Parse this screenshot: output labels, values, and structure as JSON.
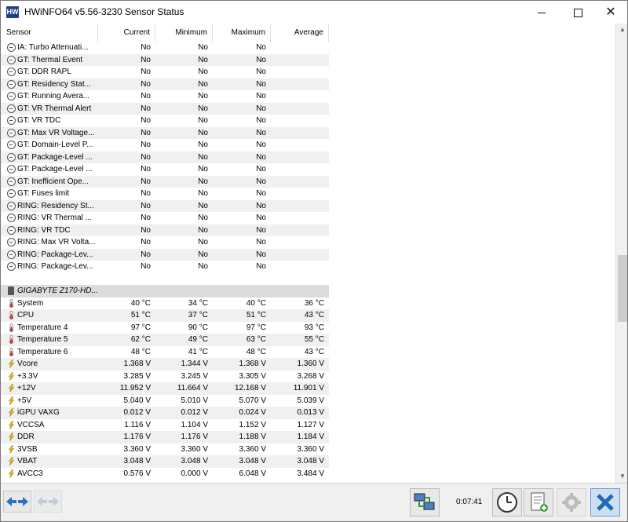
{
  "window": {
    "title": "HWiNFO64 v5.56-3230 Sensor Status",
    "icon_text": "HW"
  },
  "columns": {
    "sensor": "Sensor",
    "current": "Current",
    "minimum": "Minimum",
    "maximum": "Maximum",
    "average": "Average"
  },
  "rows": [
    {
      "name": "IA: Turbo Attenuati...",
      "cur": "No",
      "min": "No",
      "max": "No",
      "avg": "",
      "icon": "circle-minus-icon"
    },
    {
      "name": "GT: Thermal Event",
      "cur": "No",
      "min": "No",
      "max": "No",
      "avg": "",
      "icon": "circle-minus-icon"
    },
    {
      "name": "GT: DDR RAPL",
      "cur": "No",
      "min": "No",
      "max": "No",
      "avg": "",
      "icon": "circle-minus-icon"
    },
    {
      "name": "GT: Residency Stat...",
      "cur": "No",
      "min": "No",
      "max": "No",
      "avg": "",
      "icon": "circle-minus-icon"
    },
    {
      "name": "GT: Running Avera...",
      "cur": "No",
      "min": "No",
      "max": "No",
      "avg": "",
      "icon": "circle-minus-icon"
    },
    {
      "name": "GT: VR Thermal Alert",
      "cur": "No",
      "min": "No",
      "max": "No",
      "avg": "",
      "icon": "circle-minus-icon"
    },
    {
      "name": "GT: VR TDC",
      "cur": "No",
      "min": "No",
      "max": "No",
      "avg": "",
      "icon": "circle-minus-icon"
    },
    {
      "name": "GT: Max VR Voltage...",
      "cur": "No",
      "min": "No",
      "max": "No",
      "avg": "",
      "icon": "circle-minus-icon"
    },
    {
      "name": "GT: Domain-Level P...",
      "cur": "No",
      "min": "No",
      "max": "No",
      "avg": "",
      "icon": "circle-minus-icon"
    },
    {
      "name": "GT: Package-Level ...",
      "cur": "No",
      "min": "No",
      "max": "No",
      "avg": "",
      "icon": "circle-minus-icon"
    },
    {
      "name": "GT: Package-Level ...",
      "cur": "No",
      "min": "No",
      "max": "No",
      "avg": "",
      "icon": "circle-minus-icon"
    },
    {
      "name": "GT: Inefficient Ope...",
      "cur": "No",
      "min": "No",
      "max": "No",
      "avg": "",
      "icon": "circle-minus-icon"
    },
    {
      "name": "GT: Fuses limit",
      "cur": "No",
      "min": "No",
      "max": "No",
      "avg": "",
      "icon": "circle-minus-icon"
    },
    {
      "name": "RING: Residency St...",
      "cur": "No",
      "min": "No",
      "max": "No",
      "avg": "",
      "icon": "circle-minus-icon"
    },
    {
      "name": "RING: VR Thermal ...",
      "cur": "No",
      "min": "No",
      "max": "No",
      "avg": "",
      "icon": "circle-minus-icon"
    },
    {
      "name": "RING: VR TDC",
      "cur": "No",
      "min": "No",
      "max": "No",
      "avg": "",
      "icon": "circle-minus-icon"
    },
    {
      "name": "RING: Max VR Volta...",
      "cur": "No",
      "min": "No",
      "max": "No",
      "avg": "",
      "icon": "circle-minus-icon"
    },
    {
      "name": "RING: Package-Lev...",
      "cur": "No",
      "min": "No",
      "max": "No",
      "avg": "",
      "icon": "circle-minus-icon"
    },
    {
      "name": "RING: Package-Lev...",
      "cur": "No",
      "min": "No",
      "max": "No",
      "avg": "",
      "icon": "circle-minus-icon"
    },
    {
      "type": "spacer"
    },
    {
      "type": "group",
      "name": "GIGABYTE Z170-HD...",
      "icon": "chip-icon"
    },
    {
      "name": "System",
      "cur": "40 °C",
      "min": "34 °C",
      "max": "40 °C",
      "avg": "36 °C",
      "icon": "thermometer-icon"
    },
    {
      "name": "CPU",
      "cur": "51 °C",
      "min": "37 °C",
      "max": "51 °C",
      "avg": "43 °C",
      "icon": "thermometer-icon"
    },
    {
      "name": "Temperature 4",
      "cur": "97 °C",
      "min": "90 °C",
      "max": "97 °C",
      "avg": "93 °C",
      "icon": "thermometer-icon"
    },
    {
      "name": "Temperature 5",
      "cur": "62 °C",
      "min": "49 °C",
      "max": "63 °C",
      "avg": "55 °C",
      "icon": "thermometer-icon"
    },
    {
      "name": "Temperature 6",
      "cur": "48 °C",
      "min": "41 °C",
      "max": "48 °C",
      "avg": "43 °C",
      "icon": "thermometer-icon"
    },
    {
      "name": "Vcore",
      "cur": "1.368 V",
      "min": "1.344 V",
      "max": "1.368 V",
      "avg": "1.360 V",
      "icon": "lightning-icon"
    },
    {
      "name": "+3.3V",
      "cur": "3.285 V",
      "min": "3.245 V",
      "max": "3.305 V",
      "avg": "3.268 V",
      "icon": "lightning-icon"
    },
    {
      "name": "+12V",
      "cur": "11.952 V",
      "min": "11.664 V",
      "max": "12.168 V",
      "avg": "11.901 V",
      "icon": "lightning-icon"
    },
    {
      "name": "+5V",
      "cur": "5.040 V",
      "min": "5.010 V",
      "max": "5.070 V",
      "avg": "5.039 V",
      "icon": "lightning-icon"
    },
    {
      "name": "iGPU VAXG",
      "cur": "0.012 V",
      "min": "0.012 V",
      "max": "0.024 V",
      "avg": "0.013 V",
      "icon": "lightning-icon"
    },
    {
      "name": "VCCSA",
      "cur": "1.116 V",
      "min": "1.104 V",
      "max": "1.152 V",
      "avg": "1.127 V",
      "icon": "lightning-icon"
    },
    {
      "name": "DDR",
      "cur": "1.176 V",
      "min": "1.176 V",
      "max": "1.188 V",
      "avg": "1.184 V",
      "icon": "lightning-icon"
    },
    {
      "name": "3VSB",
      "cur": "3.360 V",
      "min": "3.360 V",
      "max": "3.360 V",
      "avg": "3.360 V",
      "icon": "lightning-icon"
    },
    {
      "name": "VBAT",
      "cur": "3.048 V",
      "min": "3.048 V",
      "max": "3.048 V",
      "avg": "3.048 V",
      "icon": "lightning-icon"
    },
    {
      "name": "AVCC3",
      "cur": "0.576 V",
      "min": "0.000 V",
      "max": "6.048 V",
      "avg": "3.484 V",
      "icon": "lightning-icon"
    }
  ],
  "bottom": {
    "timer": "0:07:41"
  },
  "colors": {
    "accent_blue": "#2a72c8",
    "thermo_red": "#d23c3c",
    "bolt_yellow": "#f0c020"
  }
}
